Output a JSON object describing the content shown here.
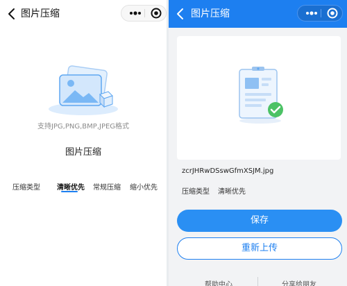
{
  "left_screen": {
    "nav": {
      "back_icon": "chevron-left-icon",
      "title": "图片压缩",
      "capsule_icons": [
        "more-dots-icon",
        "close-target-icon"
      ]
    },
    "illustration_icon": "image-photo-icon",
    "formats_hint": "支持JPG,PNG,BMP,JPEG格式",
    "feature_title": "图片压缩",
    "compress_options": {
      "label": "压缩类型",
      "items": [
        {
          "label": "清晰优先",
          "selected": true
        },
        {
          "label": "常规压缩",
          "selected": false
        },
        {
          "label": "缩小优先",
          "selected": false
        }
      ]
    }
  },
  "right_screen": {
    "nav": {
      "back_icon": "chevron-left-icon",
      "title": "图片压缩",
      "capsule_icons": [
        "more-dots-icon",
        "close-target-icon"
      ]
    },
    "preview_icon": "document-check-icon",
    "filename": "zcrJHRwDSswGfmXSJM.jpg",
    "compress_type_label": "压缩类型",
    "compress_type_value": "清晰优先",
    "save_button": "保存",
    "reupload_button": "重新上传",
    "footer": {
      "help": "帮助中心",
      "share": "分享给朋友"
    },
    "colors": {
      "accent": "#1d7ff0",
      "success": "#4cc265"
    }
  }
}
